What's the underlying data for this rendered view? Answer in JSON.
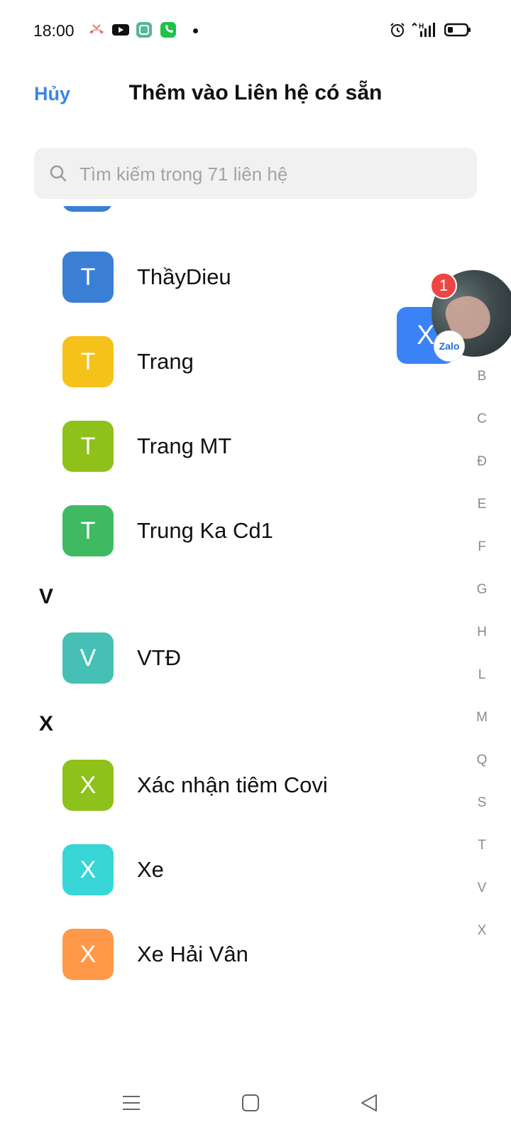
{
  "status_bar": {
    "time": "18:00",
    "icons": [
      "missed-call-icon",
      "youtube-icon",
      "app-icon",
      "phone-app-icon",
      "notification-dot",
      "alarm-icon",
      "signal-icon",
      "battery-icon"
    ],
    "network": "H"
  },
  "header": {
    "cancel_label": "Hủy",
    "title": "Thêm vào Liên hệ có sẵn"
  },
  "search": {
    "placeholder": "Tìm kiếm trong 71 liên hệ"
  },
  "contacts": [
    {
      "initial": "T",
      "name": "ThầyDieu",
      "color": "#3a7fd5"
    },
    {
      "initial": "T",
      "name": "Trang",
      "color": "#f5c21b"
    },
    {
      "initial": "T",
      "name": "Trang MT",
      "color": "#8ec11a"
    },
    {
      "initial": "T",
      "name": "Trung Ka Cd1",
      "color": "#3fba63"
    },
    {
      "section": "V"
    },
    {
      "initial": "V",
      "name": "VTĐ",
      "color": "#46c0b4"
    },
    {
      "section": "X"
    },
    {
      "initial": "X",
      "name": "Xác nhận tiêm Covi",
      "color": "#8ec11a"
    },
    {
      "initial": "X",
      "name": "Xe",
      "color": "#38d6d6"
    },
    {
      "initial": "X",
      "name": "Xe Hải Vân",
      "color": "#ff9848"
    }
  ],
  "alphabet_index": [
    "B",
    "C",
    "Đ",
    "E",
    "F",
    "G",
    "H",
    "L",
    "M",
    "Q",
    "S",
    "T",
    "V",
    "X"
  ],
  "floating": {
    "letter": "X",
    "badge_count": "1",
    "app_label": "Zalo"
  }
}
